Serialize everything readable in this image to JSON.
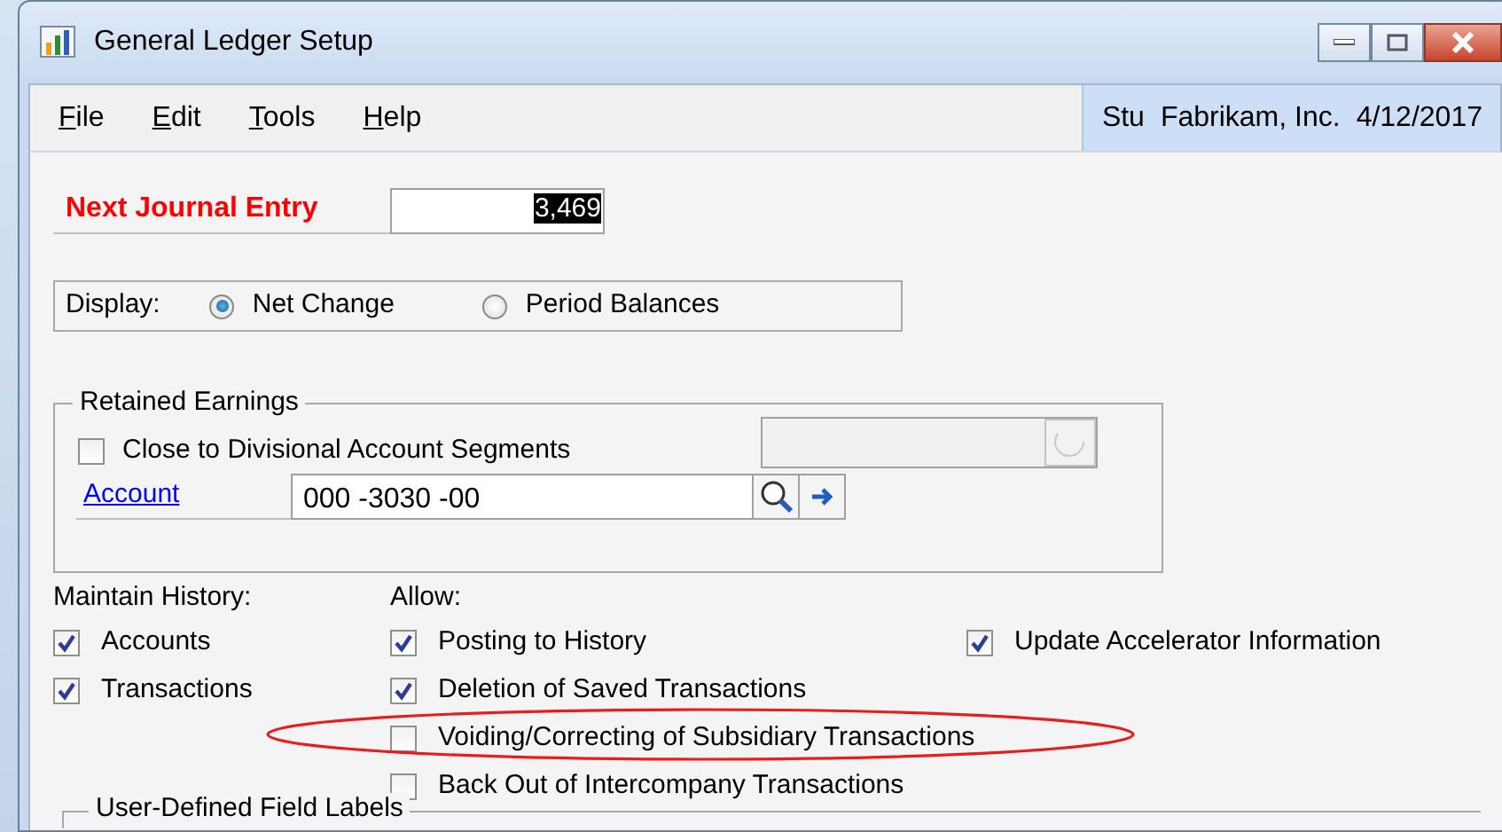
{
  "window": {
    "title": "General Ledger Setup"
  },
  "menu": [
    {
      "label": "File"
    },
    {
      "label": "Edit"
    },
    {
      "label": "Tools"
    },
    {
      "label": "Help"
    }
  ],
  "status": {
    "user": "Stu",
    "company": "Fabrikam, Inc.",
    "date": "4/12/2017"
  },
  "next_journal_entry": {
    "label": "Next Journal Entry",
    "value": "3,469"
  },
  "display": {
    "label": "Display:",
    "options": [
      {
        "label": "Net Change",
        "selected": true
      },
      {
        "label": "Period Balances",
        "selected": false
      }
    ]
  },
  "retained_earnings": {
    "title": "Retained Earnings",
    "close_to_divisional": {
      "label": "Close to Divisional Account Segments",
      "checked": false
    },
    "account_link": "Account",
    "account_value": "000 -3030 -00"
  },
  "maintain_history": {
    "label": "Maintain History:",
    "items": [
      {
        "label": "Accounts",
        "checked": true
      },
      {
        "label": "Transactions",
        "checked": true
      }
    ]
  },
  "allow": {
    "label": "Allow:",
    "items": [
      {
        "label": "Posting to History",
        "checked": true
      },
      {
        "label": "Deletion of Saved Transactions",
        "checked": true
      },
      {
        "label": "Voiding/Correcting of Subsidiary Transactions",
        "checked": false
      },
      {
        "label": "Back Out of Intercompany Transactions",
        "checked": false
      }
    ]
  },
  "update_accelerator": {
    "label": "Update Accelerator Information",
    "checked": true
  },
  "user_defined_section": {
    "title": "User-Defined Field Labels"
  }
}
